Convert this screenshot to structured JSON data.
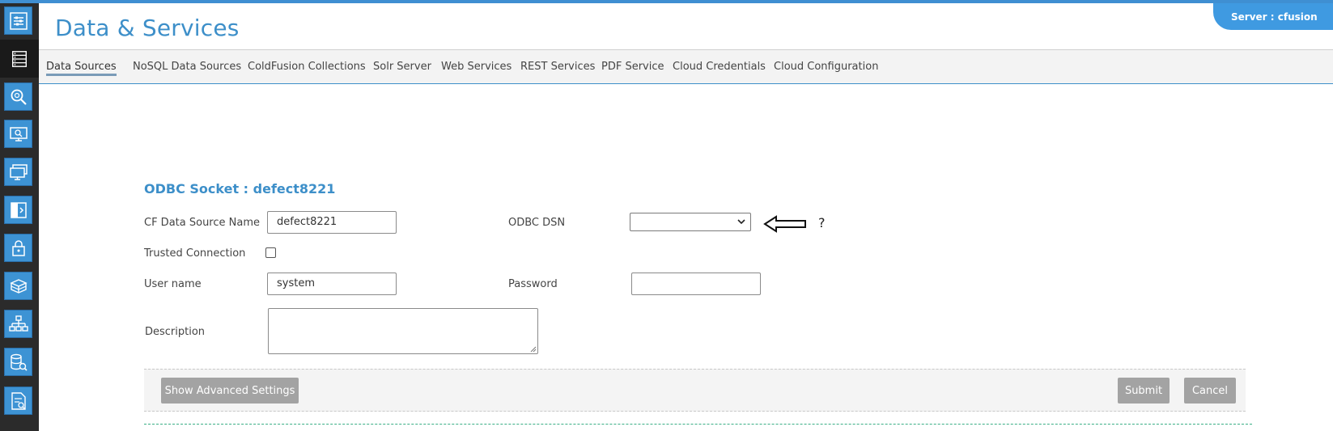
{
  "header": {
    "title": "Data & Services",
    "server_label": "Server : cfusion"
  },
  "sidebar": {
    "items": [
      {
        "icon": "settings-sliders-icon"
      },
      {
        "icon": "data-services-icon",
        "active": true
      },
      {
        "icon": "debugging-search-icon"
      },
      {
        "icon": "server-monitoring-icon"
      },
      {
        "icon": "server-manager-icon"
      },
      {
        "icon": "extensions-icon"
      },
      {
        "icon": "security-lock-icon"
      },
      {
        "icon": "packaging-box-icon"
      },
      {
        "icon": "enterprise-network-icon"
      },
      {
        "icon": "database-search-icon"
      },
      {
        "icon": "document-log-icon"
      }
    ]
  },
  "tabs": [
    {
      "label": "Data Sources",
      "active": true
    },
    {
      "label": "NoSQL Data Sources"
    },
    {
      "label": "ColdFusion Collections"
    },
    {
      "label": "Solr Server"
    },
    {
      "label": "Web Services"
    },
    {
      "label": "REST Services"
    },
    {
      "label": "PDF Service"
    },
    {
      "label": "Cloud Credentials"
    },
    {
      "label": "Cloud Configuration"
    }
  ],
  "form": {
    "title": "ODBC Socket :  defect8221",
    "fields": {
      "cf_data_source_name": {
        "label": "CF Data Source Name",
        "value": "defect8221"
      },
      "odbc_dsn": {
        "label": "ODBC DSN",
        "value": ""
      },
      "trusted_connection": {
        "label": "Trusted Connection",
        "checked": false
      },
      "user_name": {
        "label": "User name",
        "value": "system"
      },
      "password": {
        "label": "Password",
        "value": ""
      },
      "description": {
        "label": "Description",
        "value": ""
      }
    },
    "help_mark": "?"
  },
  "buttons": {
    "advanced": "Show Advanced Settings",
    "submit": "Submit",
    "cancel": "Cancel"
  },
  "colors": {
    "accent": "#3d8fc9",
    "sidebar_bg": "#2b2b2b",
    "sidebar_icon_bg": "#3d93d4",
    "server_badge": "#3f9ae1",
    "button_gray": "#a3a3a3"
  }
}
